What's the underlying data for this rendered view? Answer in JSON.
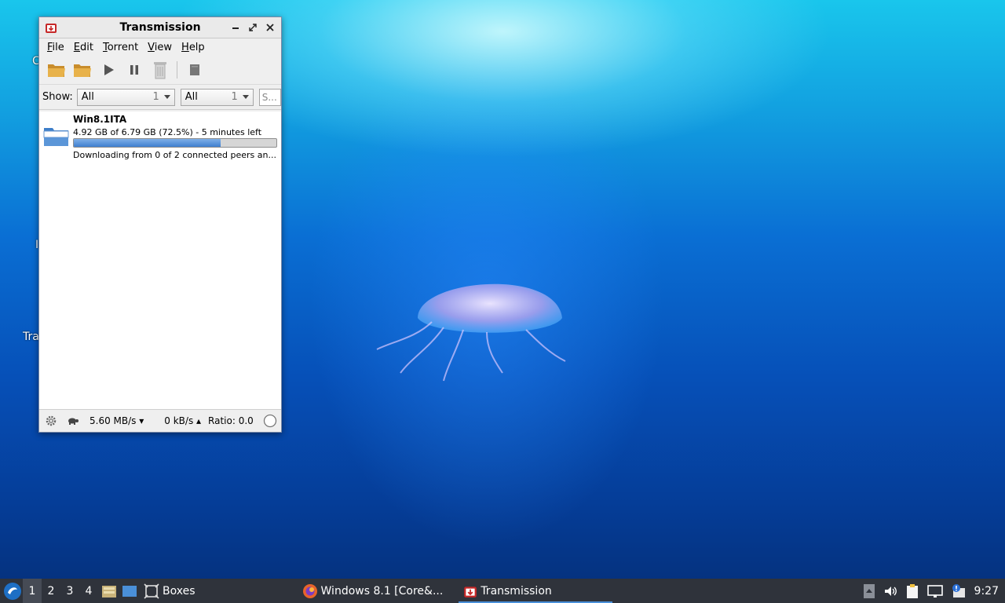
{
  "desktop": {
    "icon_label_fragments": [
      "C",
      "I",
      "Tra"
    ]
  },
  "window": {
    "title": "Transmission",
    "menu": [
      {
        "mnemonic": "F",
        "rest": "ile"
      },
      {
        "mnemonic": "E",
        "rest": "dit"
      },
      {
        "mnemonic": "T",
        "rest": "orrent"
      },
      {
        "mnemonic": "V",
        "rest": "iew"
      },
      {
        "mnemonic": "H",
        "rest": "elp"
      }
    ],
    "toolbar_icons": [
      "open-icon",
      "open-url-icon",
      "start-icon",
      "pause-icon",
      "remove-icon",
      "properties-icon"
    ],
    "filter": {
      "label": "Show:",
      "activity": {
        "value": "All",
        "count": "1"
      },
      "tracker": {
        "value": "All",
        "count": "1"
      },
      "search_placeholder": "S..."
    },
    "torrents": [
      {
        "name": "Win8.1ITA",
        "progress_text": "4.92 GB of 6.79 GB (72.5%) - 5 minutes left",
        "progress": 0.725,
        "status": "Downloading from 0 of 2 connected peers an..."
      }
    ],
    "statusbar": {
      "download_rate": "5.60 MB/s ▾",
      "upload_rate": "0 kB/s ▴",
      "ratio": "Ratio: 0.0"
    }
  },
  "taskbar": {
    "workspaces": [
      "1",
      "2",
      "3",
      "4"
    ],
    "active_workspace": "1",
    "tasks": [
      {
        "label": "Boxes"
      },
      {
        "label": "Windows 8.1 [Core&..."
      },
      {
        "label": "Transmission"
      }
    ],
    "clock": "9:27",
    "accent_color": "#4a90d9"
  },
  "colors": {
    "progress_fill": "#3f7fcf",
    "taskbar_bg": "#2f333b"
  }
}
